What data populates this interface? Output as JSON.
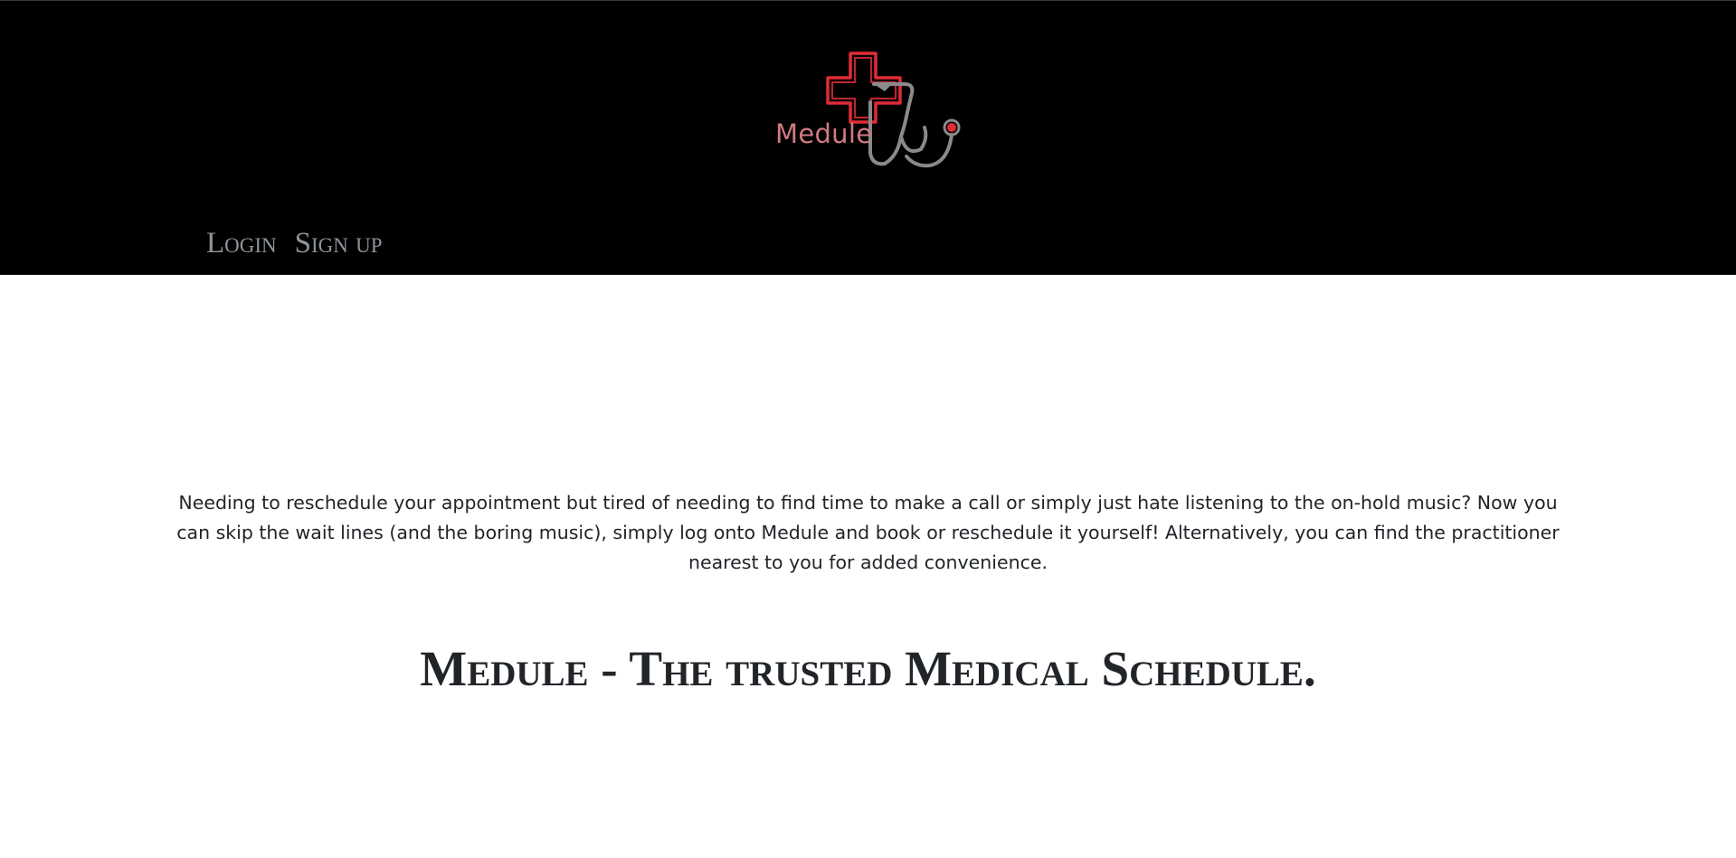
{
  "brand": {
    "name": "Medule",
    "logo_icon": "cross-stethoscope-icon",
    "colors": {
      "cross": "#e02b35",
      "stethoscope": "#8a8a8a",
      "text": "#d07a80"
    }
  },
  "nav": {
    "login_label": "Login",
    "signup_label": "Sign up"
  },
  "main": {
    "intro": "Needing to reschedule your appointment but tired of needing to find time to make a call or simply just hate listening to the on-hold music? Now you can skip the wait lines (and the boring music), simply log onto Medule and book or reschedule it yourself! Alternatively, you can find the practitioner nearest to you for added convenience.",
    "headline": "Medule - The trusted Medical Schedule."
  },
  "theme": {
    "header_bg": "#000000",
    "nav_text": "#8f949b",
    "body_text": "#212529"
  }
}
